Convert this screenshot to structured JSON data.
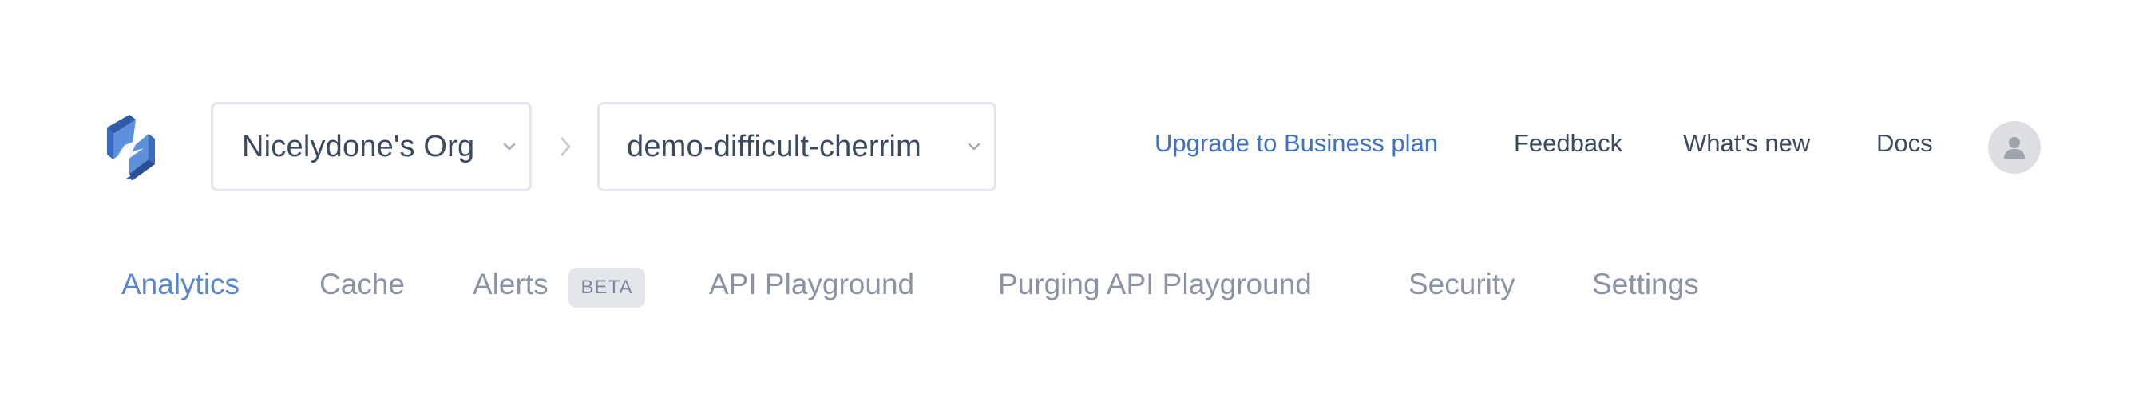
{
  "header": {
    "logo_icon": "bolt-logo-icon",
    "org_selector": {
      "label": "Nicelydone's Org",
      "icon": "chevron-down-icon"
    },
    "breadcrumb_separator_icon": "chevron-right-icon",
    "project_selector": {
      "label": "demo-difficult-cherrim",
      "icon": "chevron-down-icon"
    },
    "links": {
      "upgrade": "Upgrade to Business plan",
      "feedback": "Feedback",
      "whats_new": "What's new",
      "docs": "Docs"
    },
    "avatar_icon": "user-icon"
  },
  "tabs": {
    "analytics": "Analytics",
    "cache": "Cache",
    "alerts": "Alerts",
    "alerts_badge": "BETA",
    "api_playground": "API Playground",
    "purging_api_playground": "Purging API Playground",
    "security": "Security",
    "settings": "Settings",
    "active": "Analytics"
  },
  "colors": {
    "accent_link": "#3f72c2",
    "active_tab": "#5b87cf",
    "inactive_tab": "#8a94a6",
    "text_dark": "#3b4a61",
    "logo_blue": "#4f7fd0",
    "logo_dark": "#2e5aa8"
  }
}
